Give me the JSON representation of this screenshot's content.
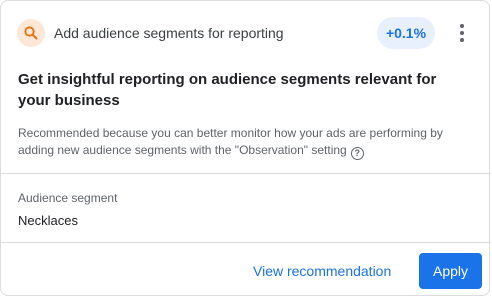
{
  "header": {
    "icon": "search-icon",
    "title": "Add audience segments for reporting",
    "uplift": "+0.1%",
    "more_icon": "more-vert-icon",
    "colors": {
      "icon_bg": "#fde7d6",
      "icon_fg": "#e8710a",
      "badge_bg": "#e8f0fe",
      "badge_fg": "#1a73e8"
    }
  },
  "body": {
    "headline": "Get insightful reporting on audience segments relevant for your business",
    "reason": "Recommended because you can better monitor how your ads are performing by adding new audience segments with the \"Observation\" setting",
    "help_icon": "help-icon"
  },
  "segment": {
    "label": "Audience segment",
    "value": "Necklaces"
  },
  "actions": {
    "view_label": "View recommendation",
    "apply_label": "Apply",
    "accent": "#1a73e8"
  }
}
